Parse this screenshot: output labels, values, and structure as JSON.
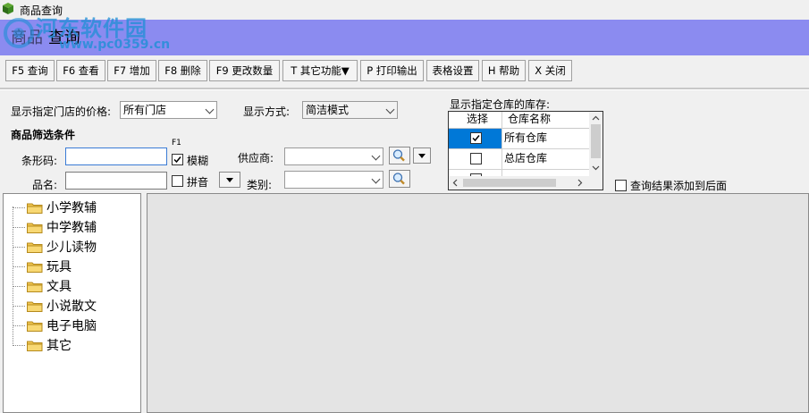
{
  "window": {
    "title": "商品查询"
  },
  "watermark": {
    "site": "河东软件园",
    "url": "www.pc0359.cn"
  },
  "banner": {
    "heading": "查询",
    "under": "商品"
  },
  "toolbar": {
    "buttons": [
      {
        "label": "F5 查询"
      },
      {
        "label": "F6 查看"
      },
      {
        "label": "F7 增加"
      },
      {
        "label": "F8 删除"
      },
      {
        "label": "F9 更改数量"
      },
      {
        "label": "T 其它功能▼"
      },
      {
        "label": "P 打印输出"
      },
      {
        "label": "表格设置"
      },
      {
        "label": "H 帮助"
      },
      {
        "label": "X 关闭"
      }
    ]
  },
  "filters": {
    "store_price_label": "显示指定门店的价格:",
    "store_price_value": "所有门店",
    "display_mode_label": "显示方式:",
    "display_mode_value": "简洁模式",
    "section_title": "商品筛选条件",
    "barcode_label": "条形码:",
    "barcode_value": "",
    "f1_hint": "F1",
    "fuzzy_label": "模糊",
    "fuzzy_checked": true,
    "name_label": "品名:",
    "name_value": "",
    "pinyin_label": "拼音",
    "pinyin_checked": false,
    "supplier_label": "供应商:",
    "supplier_value": "",
    "category_label": "类别:",
    "category_value": "",
    "append_label": "查询结果添加到后面",
    "append_checked": false
  },
  "warehouse": {
    "label": "显示指定仓库的库存:",
    "col_select": "选择",
    "col_name": "仓库名称",
    "rows": [
      {
        "name": "所有仓库",
        "checked": true,
        "selected": true
      },
      {
        "name": "总店仓库",
        "checked": false,
        "selected": false
      }
    ]
  },
  "tree": {
    "items": [
      {
        "label": "小学教辅"
      },
      {
        "label": "中学教辅"
      },
      {
        "label": "少儿读物"
      },
      {
        "label": "玩具"
      },
      {
        "label": "文具"
      },
      {
        "label": "小说散文"
      },
      {
        "label": "电子电脑"
      },
      {
        "label": "其它"
      }
    ]
  },
  "colors": {
    "banner": "#8b8bf0",
    "selection": "#0078d7",
    "watermark": "#1f8fd6"
  }
}
